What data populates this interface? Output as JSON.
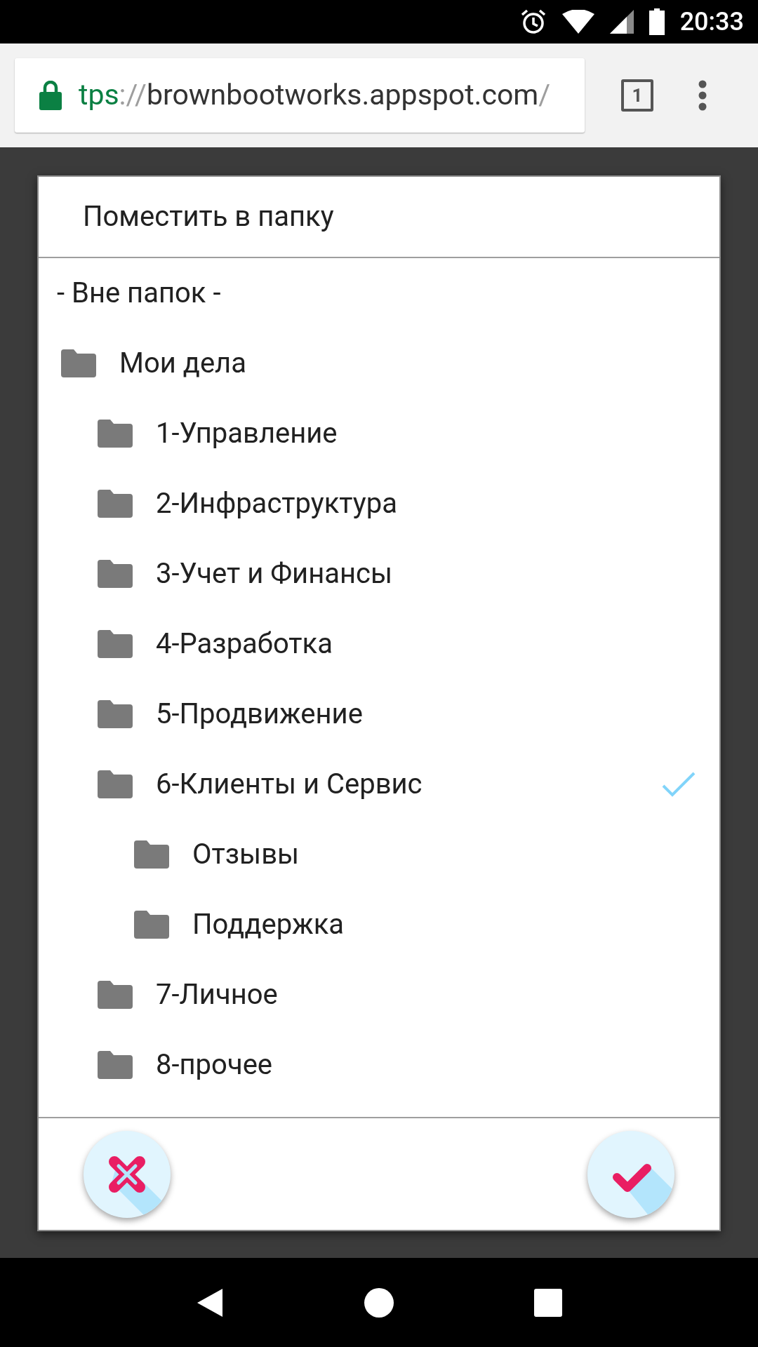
{
  "status_bar": {
    "time": "20:33"
  },
  "browser": {
    "url": {
      "scheme": "tps",
      "separator": "://",
      "host": "brownbootworks.appspot.com",
      "path": "/"
    },
    "tab_count": "1"
  },
  "dialog": {
    "title": "Поместить в папку",
    "items": [
      {
        "kind": "no_folder",
        "label": "- Вне папок -",
        "selected": false
      },
      {
        "kind": "folder",
        "label": "Мои дела",
        "selected": false,
        "children": [
          {
            "kind": "folder",
            "label": "1-Управление",
            "selected": false
          },
          {
            "kind": "folder",
            "label": "2-Инфраструктура",
            "selected": false
          },
          {
            "kind": "folder",
            "label": "3-Учет и Финансы",
            "selected": false
          },
          {
            "kind": "folder",
            "label": "4-Разработка",
            "selected": false
          },
          {
            "kind": "folder",
            "label": "5-Продвижение",
            "selected": false
          },
          {
            "kind": "folder",
            "label": "6-Клиенты и Сервис",
            "selected": true,
            "children": [
              {
                "kind": "folder",
                "label": "Отзывы",
                "selected": false
              },
              {
                "kind": "folder",
                "label": "Поддержка",
                "selected": false
              }
            ]
          },
          {
            "kind": "folder",
            "label": "7-Личное",
            "selected": false
          },
          {
            "kind": "folder",
            "label": "8-прочее",
            "selected": false
          }
        ]
      }
    ]
  }
}
